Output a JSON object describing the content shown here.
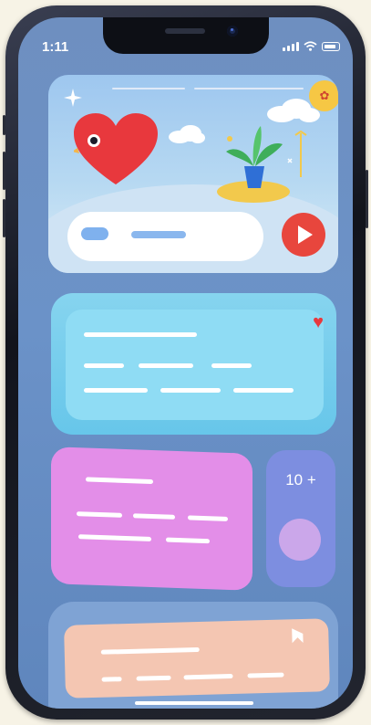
{
  "status_bar": {
    "time": "1:11",
    "battery_icon": "battery-icon",
    "wifi_icon": "wifi-icon",
    "signal_icon": "signal-icon"
  },
  "hero_card": {
    "decor_icons": [
      "sparkle-icon",
      "heart-bird-icon",
      "cloud-icon",
      "plant-pot-icon",
      "badge-icon"
    ],
    "badge_glyph": "✿"
  },
  "info_card": {
    "heart_glyph": "♥"
  },
  "counter_card": {
    "label": "10 +"
  },
  "colors": {
    "accent": "#e8463d",
    "heart": "#e8383d",
    "cyan_card": "#6fcbec",
    "pink_card": "#e38ee8",
    "violet_card": "#7d8ee0",
    "peach_card": "#f4c6b2"
  }
}
